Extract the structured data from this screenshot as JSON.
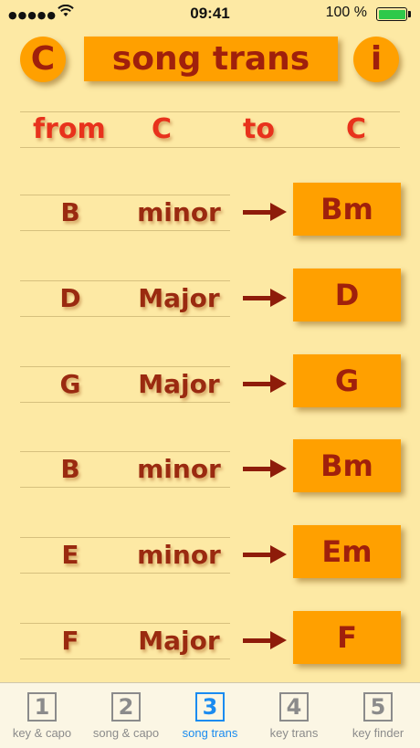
{
  "status_bar": {
    "signal": "●●●●●",
    "time": "09:41",
    "battery_percent": "100 %"
  },
  "header": {
    "key_button": "C",
    "title": "song trans",
    "info_button": "i"
  },
  "transpose": {
    "from_label": "from",
    "from_key": "C",
    "to_label": "to",
    "to_key": "C"
  },
  "chords": [
    {
      "note": "B",
      "quality": "minor",
      "result": "Bm"
    },
    {
      "note": "D",
      "quality": "Major",
      "result": "D"
    },
    {
      "note": "G",
      "quality": "Major",
      "result": "G"
    },
    {
      "note": "B",
      "quality": "minor",
      "result": "Bm"
    },
    {
      "note": "E",
      "quality": "minor",
      "result": "Em"
    },
    {
      "note": "F",
      "quality": "Major",
      "result": "F"
    }
  ],
  "tabs": [
    {
      "number": "1",
      "label": "key & capo",
      "active": false
    },
    {
      "number": "2",
      "label": "song & capo",
      "active": false
    },
    {
      "number": "3",
      "label": "song trans",
      "active": true
    },
    {
      "number": "4",
      "label": "key trans",
      "active": false
    },
    {
      "number": "5",
      "label": "key finder",
      "active": false
    }
  ],
  "colors": {
    "background": "#fde9a4",
    "button": "#ffa000",
    "accent_text": "#a0200c",
    "header_text": "#e8321c",
    "active_tab": "#1a8bf0",
    "inactive_tab": "#8b8b8b"
  }
}
